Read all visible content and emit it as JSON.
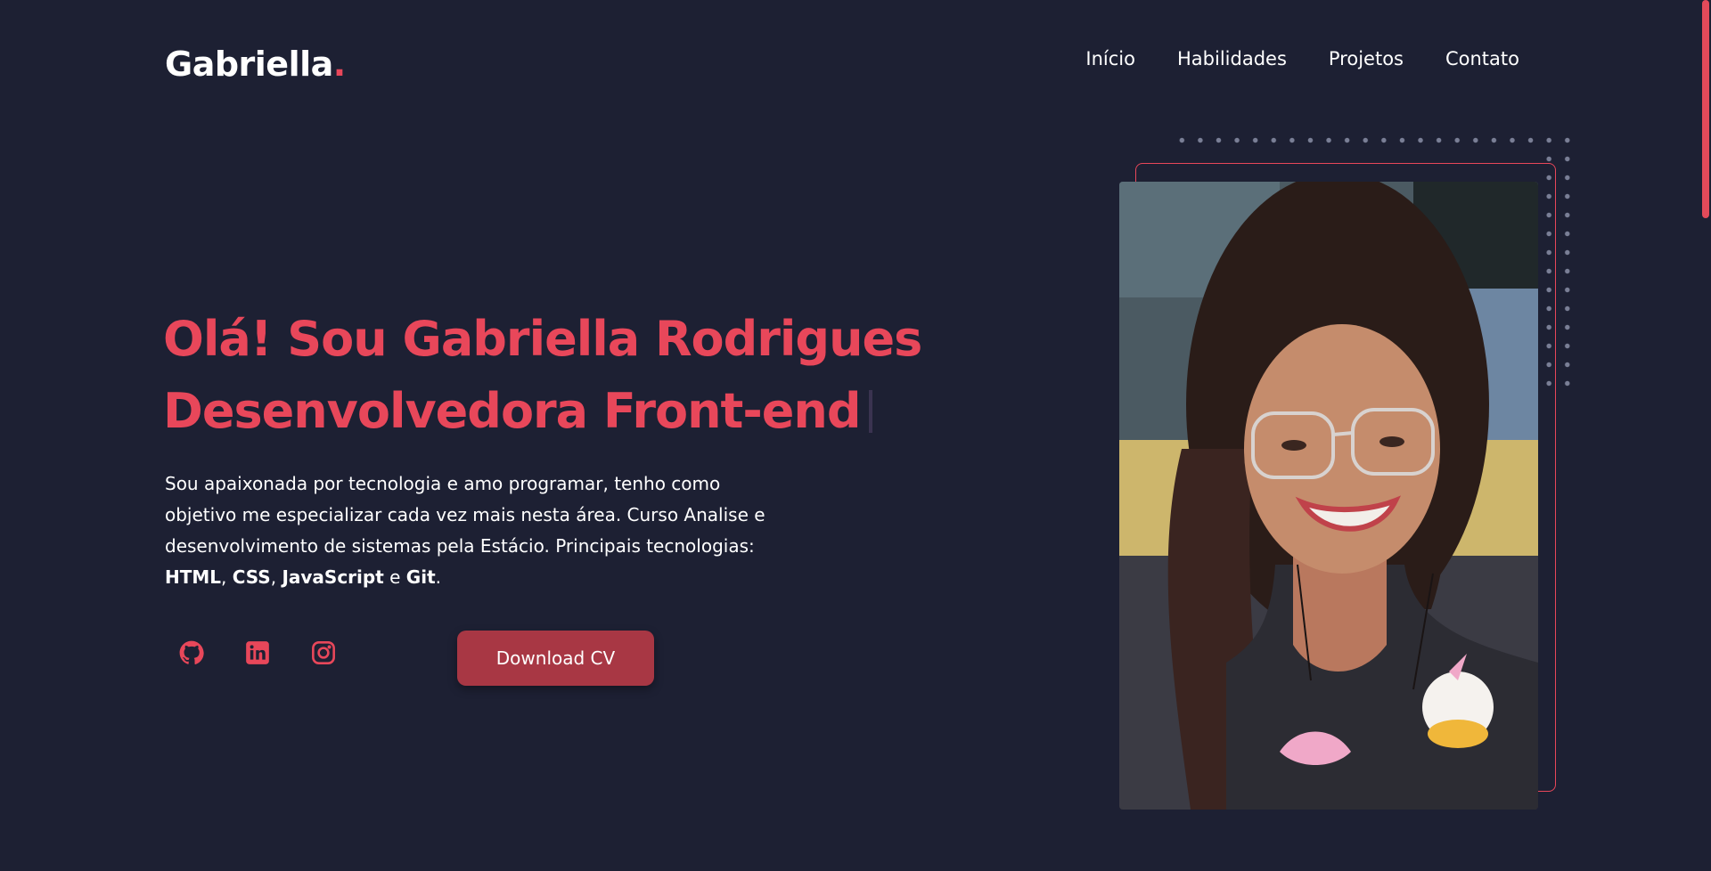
{
  "header": {
    "logo_text": "Gabriella",
    "logo_dot": ".",
    "nav": [
      {
        "label": "Início"
      },
      {
        "label": "Habilidades"
      },
      {
        "label": "Projetos"
      },
      {
        "label": "Contato"
      }
    ]
  },
  "hero": {
    "headline_line1": "Olá! Sou Gabriella Rodrigues",
    "headline_line2": "Desenvolvedora Front-end",
    "description_part1": "Sou apaixonada por tecnologia e amo programar, tenho como objetivo me especializar cada vez mais nesta área. Curso Analise e desenvolvimento de sistemas pela Estácio. Principais tecnologias: ",
    "tech_html": "HTML",
    "sep1": ", ",
    "tech_css": "CSS",
    "sep2": ", ",
    "tech_js": "JavaScript",
    "sep3": " e ",
    "tech_git": "Git",
    "end": ".",
    "download_label": "Download CV"
  },
  "social": [
    {
      "icon": "github-icon"
    },
    {
      "icon": "linkedin-icon"
    },
    {
      "icon": "instagram-icon"
    }
  ],
  "colors": {
    "background": "#1d2033",
    "accent": "#e8475a",
    "button": "#a83744"
  }
}
